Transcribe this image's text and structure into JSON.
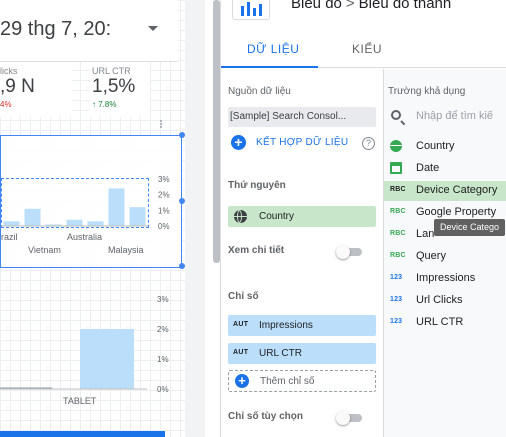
{
  "canvas": {
    "date_range": "29 thg 7, 20:",
    "scorecards": [
      {
        "label": "licks",
        "value": ",9 N",
        "delta": "4%",
        "delta_color": "#d93025"
      },
      {
        "label": "URL CTR",
        "value": "1,5%",
        "delta": "↑ 7.8%",
        "delta_color": "#188038"
      }
    ],
    "chart_top": {
      "y_ticks": [
        "3%",
        "2%",
        "1%",
        "0%"
      ],
      "x_labels_row1": [
        "razil",
        "Australia"
      ],
      "x_labels_row2": [
        "Vietnam",
        "Malaysia"
      ]
    },
    "chart_bottom": {
      "y_ticks": [
        "3%",
        "2%",
        "1%",
        "0%"
      ],
      "x_label": "TABLET"
    }
  },
  "chart_data": [
    {
      "type": "bar",
      "categories": [
        "",
        "razil",
        "",
        "Vietnam",
        "",
        "Australia",
        "Malaysia"
      ],
      "values": [
        0.3,
        1.1,
        0.1,
        0.4,
        0.3,
        2.4,
        1.2
      ],
      "ylim": [
        0,
        3
      ],
      "ylabel": "",
      "xlabel": "",
      "title": "",
      "grid": false
    },
    {
      "type": "bar",
      "categories": [
        "",
        "TABLET"
      ],
      "values": [
        0.05,
        2.0
      ],
      "ylim": [
        0,
        3
      ],
      "ylabel": "",
      "xlabel": "",
      "title": "",
      "grid": false
    }
  ],
  "header": {
    "breadcrumb_root": "Biểu đồ",
    "breadcrumb_sep": ">",
    "breadcrumb_leaf": "Biểu đồ thanh",
    "chart_icon": "bar-chart-icon"
  },
  "tabs": [
    {
      "label": "DỮ LIỆU",
      "active": true
    },
    {
      "label": "KIỂU",
      "active": false
    }
  ],
  "data_panel": {
    "source_label": "Nguồn dữ liệu",
    "source_value": "[Sample] Search Consol...",
    "blend_label": "KẾT HỢP DỮ LIỆU",
    "help_glyph": "?",
    "dimension_label": "Thứ nguyên",
    "dimension_value": "Country",
    "drilldown_label": "Xem chi tiết",
    "metric_label": "Chỉ số",
    "metrics": [
      {
        "badge": "AUT",
        "name": "Impressions"
      },
      {
        "badge": "AUT",
        "name": "URL CTR"
      }
    ],
    "add_metric_label": "Thêm chỉ số",
    "optional_metric_label": "Chỉ số tùy chọn"
  },
  "fields_panel": {
    "title": "Trường khả dụng",
    "search_placeholder": "Nhập để tìm kiế",
    "fields": [
      {
        "type": "geo",
        "badge": "",
        "name": "Country"
      },
      {
        "type": "date",
        "badge": "",
        "name": "Date"
      },
      {
        "type": "text",
        "badge": "RBC",
        "name": "Device Category",
        "selected": true
      },
      {
        "type": "text",
        "badge": "RBC",
        "name": "Google Property"
      },
      {
        "type": "text",
        "badge": "RBC",
        "name": "Lan"
      },
      {
        "type": "text",
        "badge": "RBC",
        "name": "Query"
      },
      {
        "type": "number",
        "badge": "123",
        "name": "Impressions"
      },
      {
        "type": "number",
        "badge": "123",
        "name": "Url Clicks"
      },
      {
        "type": "number",
        "badge": "123",
        "name": "URL CTR"
      }
    ],
    "drag_tooltip": "Device Catego"
  },
  "colors": {
    "accent": "#1a73e8",
    "dimension_chip": "#c8e6c9",
    "metric_chip": "#bbdefb",
    "bar": "#bbdefb"
  }
}
